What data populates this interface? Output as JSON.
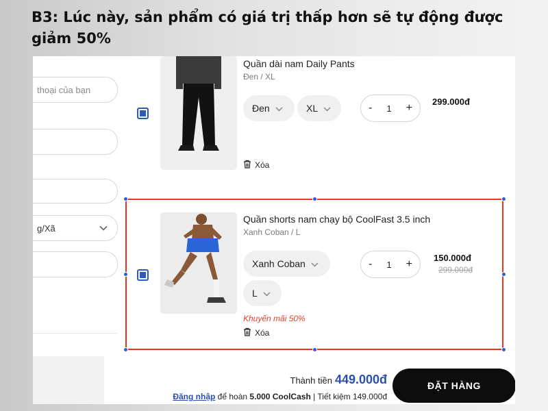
{
  "heading": {
    "line1": "B3: Lúc này, sản phẩm có giá trị thấp hơn sẽ tự động được",
    "line2": "giảm 50%"
  },
  "form": {
    "phone_placeholder": "thoại của bạn",
    "ward_value": "g/Xã"
  },
  "cart": {
    "items": [
      {
        "name": "Quần dài nam Daily Pants",
        "variant": "Đen / XL",
        "color_option": "Đen",
        "size_option": "XL",
        "quantity": "1",
        "price": "299.000đ",
        "delete_label": "Xóa",
        "checked": true
      },
      {
        "name": "Quần shorts nam chạy bộ CoolFast 3.5 inch",
        "variant": "Xanh Coban / L",
        "color_option": "Xanh Coban",
        "size_option": "L",
        "quantity": "1",
        "price": "150.000đ",
        "old_price": "299.000đ",
        "promo": "Khuyến mãi 50%",
        "delete_label": "Xóa",
        "checked": true
      }
    ],
    "qty_minus": "-",
    "qty_plus": "+"
  },
  "footer": {
    "total_label": "Thành tiền",
    "total_value": "449.000đ",
    "login_link": "Đăng nhập",
    "cash_text_1": "để hoàn",
    "cash_amount": "5.000 CoolCash",
    "cash_sep": "|",
    "savings_text": "Tiết kiệm 149.000đ",
    "order_button": "ĐẶT HÀNG"
  },
  "colors": {
    "accent_blue": "#2a4fb0",
    "highlight_red": "#e5371f",
    "promo_red": "#e0442b",
    "button_black": "#0d0d0d"
  },
  "icons": {
    "chevron": "chevron-down-icon",
    "trash": "trash-icon",
    "checkbox": "checkbox-checked-icon"
  }
}
